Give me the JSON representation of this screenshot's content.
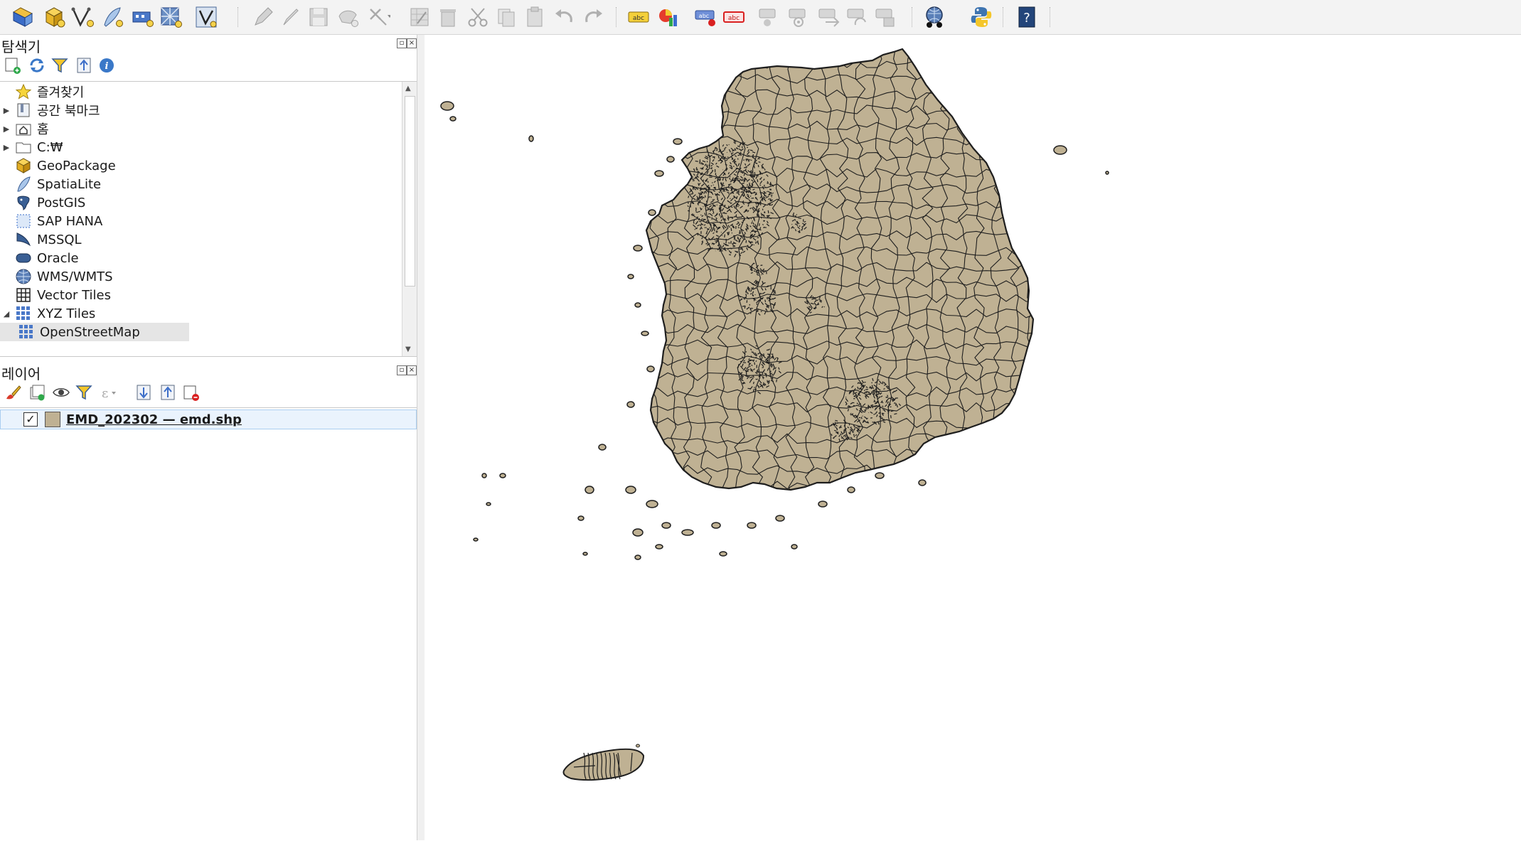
{
  "toolbar": {
    "icons": [
      "open-project-icon",
      "new-geopackage-layer-icon",
      "new-vector-layer-icon",
      "digitize-pen-icon",
      "new-virtual-layer-icon",
      "new-raster-icon",
      "vector-tool-icon",
      "edit-pencil-icon",
      "toggle-editing-icon",
      "save-edits-icon",
      "add-feature-icon",
      "vertex-tool-icon",
      "modify-attributes-icon",
      "delete-selected-icon",
      "cut-icon",
      "copy-icon",
      "paste-icon",
      "undo-icon",
      "redo-icon",
      "label-abc-icon",
      "diagram-icon",
      "pin-label-icon",
      "show-hide-labels-icon",
      "move-label-icon",
      "rotate-label-icon",
      "change-label-icon",
      "label-props-icon",
      "label-history-icon",
      "plugins-icon",
      "python-console-icon",
      "help-icon"
    ]
  },
  "browser": {
    "title": "탐색기",
    "items": [
      {
        "label": "즐겨찾기",
        "arrow": "",
        "icon": "star-icon"
      },
      {
        "label": "공간 북마크",
        "arrow": "▶",
        "icon": "bookmark-icon"
      },
      {
        "label": "홈",
        "arrow": "▶",
        "icon": "home-folder-icon"
      },
      {
        "label": "C:₩",
        "arrow": "▶",
        "icon": "drive-folder-icon"
      },
      {
        "label": "GeoPackage",
        "arrow": "",
        "icon": "geopackage-icon"
      },
      {
        "label": "SpatiaLite",
        "arrow": "",
        "icon": "spatialite-icon"
      },
      {
        "label": "PostGIS",
        "arrow": "",
        "icon": "postgis-icon"
      },
      {
        "label": "SAP HANA",
        "arrow": "",
        "icon": "sap-hana-icon"
      },
      {
        "label": "MSSQL",
        "arrow": "",
        "icon": "mssql-icon"
      },
      {
        "label": "Oracle",
        "arrow": "",
        "icon": "oracle-icon"
      },
      {
        "label": "WMS/WMTS",
        "arrow": "",
        "icon": "wms-globe-icon"
      },
      {
        "label": "Vector Tiles",
        "arrow": "",
        "icon": "vector-tiles-icon"
      },
      {
        "label": "XYZ Tiles",
        "arrow": "◢",
        "icon": "xyz-tiles-icon"
      },
      {
        "label": "OpenStreetMap",
        "arrow": "",
        "icon": "osm-tiles-icon"
      }
    ]
  },
  "layers": {
    "title": "레이어",
    "items": [
      {
        "name": "EMD_202302 — emd.shp",
        "checked": "✓",
        "swatch": "#bfb193"
      }
    ]
  },
  "map": {
    "fill": "#bfb193",
    "stroke": "#1e1e1e"
  }
}
